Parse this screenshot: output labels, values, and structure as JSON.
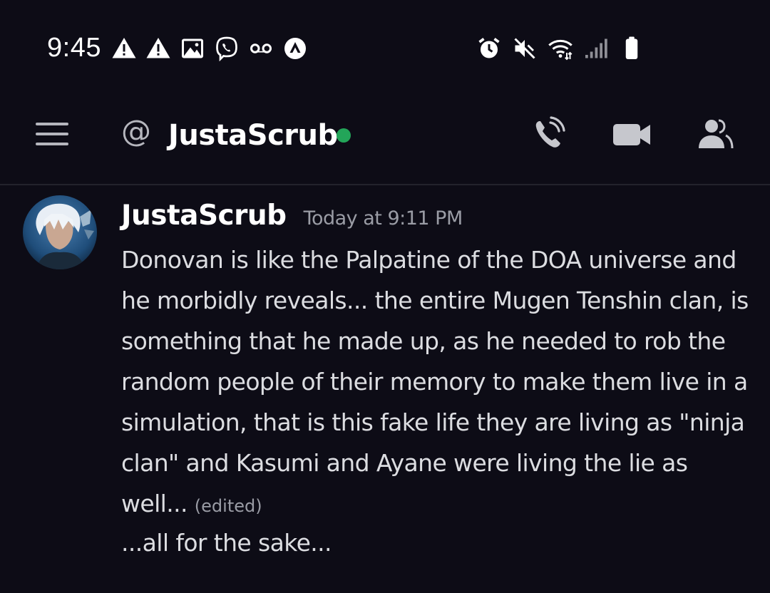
{
  "status_bar": {
    "time": "9:45",
    "left_icons": [
      "warning-icon",
      "warning-icon",
      "image-icon",
      "viber-icon",
      "voicemail-icon",
      "app-icon"
    ],
    "right_icons": [
      "alarm-icon",
      "mute-icon",
      "wifi-icon",
      "signal-icon",
      "battery-icon"
    ]
  },
  "header": {
    "channel_symbol": "@",
    "title": "JustaScrub",
    "status": "online",
    "status_color": "#23a559",
    "actions": [
      "call-icon",
      "video-icon",
      "members-icon"
    ]
  },
  "message": {
    "author": "JustaScrub",
    "timestamp": "Today at 9:11 PM",
    "text": "Donovan is like the Palpatine of the DOA universe and he morbidly reveals... the entire Mugen Tenshin clan, is something that he made up, as he needed to rob the random people of their memory to make them live in a simulation, that is this fake life they are living as \"ninja clan\" and Kasumi and Ayane were living the lie as well...",
    "edited_label": "(edited)",
    "followup": "...all for the sake..."
  },
  "colors": {
    "background": "#0d0c16",
    "text": "#dcdde1",
    "muted": "#9a9ca5"
  }
}
